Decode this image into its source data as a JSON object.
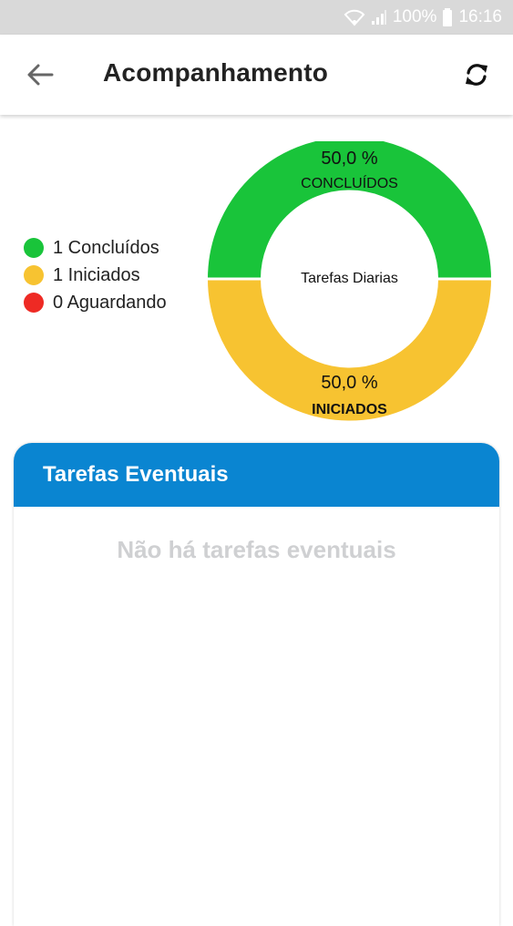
{
  "status_bar": {
    "battery": "100%",
    "time": "16:16",
    "icons": [
      "wifi-icon",
      "signal-icon",
      "battery-icon"
    ]
  },
  "app_bar": {
    "title": "Acompanhamento",
    "back_icon": "arrow-left-icon",
    "refresh_icon": "refresh-icon"
  },
  "legend": {
    "items": [
      {
        "label": "1 Concluídos",
        "color": "#19c43a"
      },
      {
        "label": "1 Iniciados",
        "color": "#f7c331"
      },
      {
        "label": "0 Aguardando",
        "color": "#ee2a24"
      }
    ]
  },
  "donut": {
    "center_label": "Tarefas Diarias",
    "top_percent": "50,0 %",
    "top_label": "CONCLUÍDOS",
    "bottom_percent": "50,0 %",
    "bottom_label": "INICIADOS"
  },
  "chart_data": {
    "type": "pie",
    "title": "Tarefas Diarias",
    "categories": [
      "CONCLUÍDOS",
      "INICIADOS"
    ],
    "values": [
      50.0,
      50.0
    ],
    "colors": [
      "#19c43a",
      "#f7c331"
    ]
  },
  "eventual": {
    "title": "Tarefas Eventuais",
    "empty_message": "Não há tarefas eventuais"
  },
  "colors": {
    "header_blue": "#0a85d1",
    "empty_text": "#cfd0d2"
  }
}
